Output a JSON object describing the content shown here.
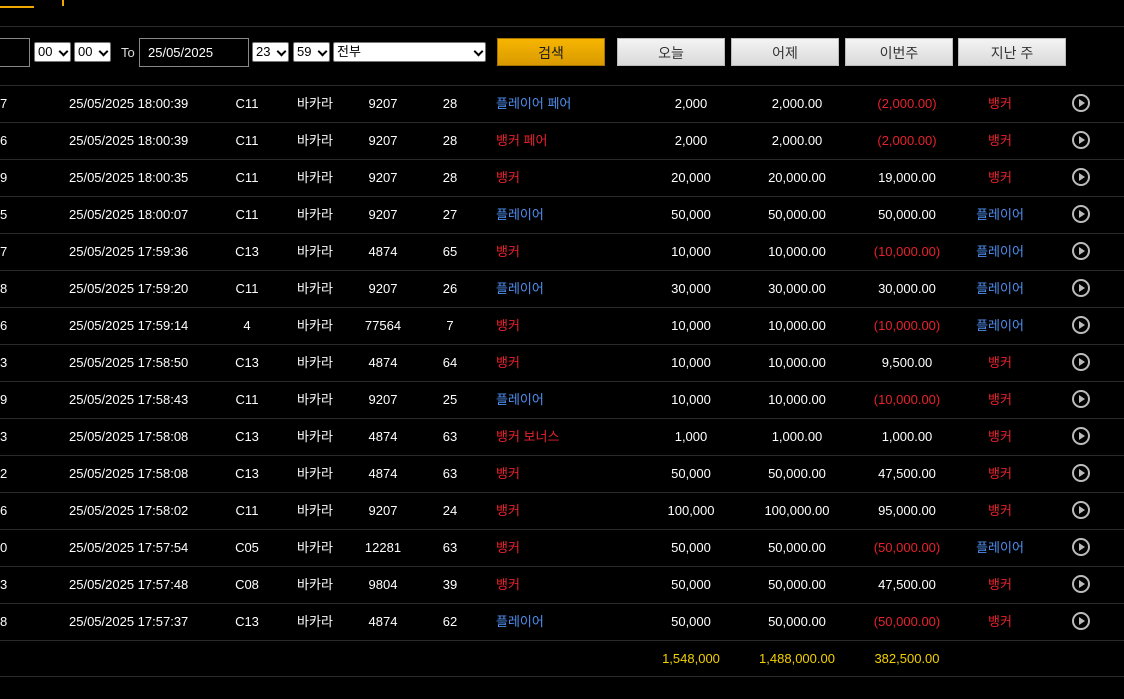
{
  "colors": {
    "accent": "#f0a800",
    "banker": "#e8212c",
    "player": "#4f8ff0",
    "total": "#f2d000"
  },
  "filters": {
    "from_hour": "00",
    "from_minute": "00",
    "to_label": "To",
    "to_date": "25/05/2025",
    "to_hour": "23",
    "to_minute": "59",
    "game_type": "전부",
    "search_label": "검색",
    "quick": [
      "오늘",
      "어제",
      "이번주",
      "지난 주"
    ]
  },
  "rows": [
    {
      "id": "7",
      "time": "25/05/2025 18:00:39",
      "table": "C11",
      "game": "바카라",
      "round": "9207",
      "shoe": "28",
      "bet": "플레이어 페어",
      "bet_color": "blue",
      "amount": "2,000",
      "valid": "2,000.00",
      "winloss": "(2,000.00)",
      "winloss_color": "red",
      "result": "뱅커",
      "result_color": "red"
    },
    {
      "id": "6",
      "time": "25/05/2025 18:00:39",
      "table": "C11",
      "game": "바카라",
      "round": "9207",
      "shoe": "28",
      "bet": "뱅커 페어",
      "bet_color": "red",
      "amount": "2,000",
      "valid": "2,000.00",
      "winloss": "(2,000.00)",
      "winloss_color": "red",
      "result": "뱅커",
      "result_color": "red"
    },
    {
      "id": "9",
      "time": "25/05/2025 18:00:35",
      "table": "C11",
      "game": "바카라",
      "round": "9207",
      "shoe": "28",
      "bet": "뱅커",
      "bet_color": "red",
      "amount": "20,000",
      "valid": "20,000.00",
      "winloss": "19,000.00",
      "winloss_color": "white",
      "result": "뱅커",
      "result_color": "red"
    },
    {
      "id": "5",
      "time": "25/05/2025 18:00:07",
      "table": "C11",
      "game": "바카라",
      "round": "9207",
      "shoe": "27",
      "bet": "플레이어",
      "bet_color": "blue",
      "amount": "50,000",
      "valid": "50,000.00",
      "winloss": "50,000.00",
      "winloss_color": "white",
      "result": "플레이어",
      "result_color": "blue"
    },
    {
      "id": "7",
      "time": "25/05/2025 17:59:36",
      "table": "C13",
      "game": "바카라",
      "round": "4874",
      "shoe": "65",
      "bet": "뱅커",
      "bet_color": "red",
      "amount": "10,000",
      "valid": "10,000.00",
      "winloss": "(10,000.00)",
      "winloss_color": "red",
      "result": "플레이어",
      "result_color": "blue"
    },
    {
      "id": "8",
      "time": "25/05/2025 17:59:20",
      "table": "C11",
      "game": "바카라",
      "round": "9207",
      "shoe": "26",
      "bet": "플레이어",
      "bet_color": "blue",
      "amount": "30,000",
      "valid": "30,000.00",
      "winloss": "30,000.00",
      "winloss_color": "white",
      "result": "플레이어",
      "result_color": "blue"
    },
    {
      "id": "6",
      "time": "25/05/2025 17:59:14",
      "table": "4",
      "game": "바카라",
      "round": "77564",
      "shoe": "7",
      "bet": "뱅커",
      "bet_color": "red",
      "amount": "10,000",
      "valid": "10,000.00",
      "winloss": "(10,000.00)",
      "winloss_color": "red",
      "result": "플레이어",
      "result_color": "blue"
    },
    {
      "id": "3",
      "time": "25/05/2025 17:58:50",
      "table": "C13",
      "game": "바카라",
      "round": "4874",
      "shoe": "64",
      "bet": "뱅커",
      "bet_color": "red",
      "amount": "10,000",
      "valid": "10,000.00",
      "winloss": "9,500.00",
      "winloss_color": "white",
      "result": "뱅커",
      "result_color": "red"
    },
    {
      "id": "9",
      "time": "25/05/2025 17:58:43",
      "table": "C11",
      "game": "바카라",
      "round": "9207",
      "shoe": "25",
      "bet": "플레이어",
      "bet_color": "blue",
      "amount": "10,000",
      "valid": "10,000.00",
      "winloss": "(10,000.00)",
      "winloss_color": "red",
      "result": "뱅커",
      "result_color": "red"
    },
    {
      "id": "3",
      "time": "25/05/2025 17:58:08",
      "table": "C13",
      "game": "바카라",
      "round": "4874",
      "shoe": "63",
      "bet": "뱅커 보너스",
      "bet_color": "red",
      "amount": "1,000",
      "valid": "1,000.00",
      "winloss": "1,000.00",
      "winloss_color": "white",
      "result": "뱅커",
      "result_color": "red"
    },
    {
      "id": "2",
      "time": "25/05/2025 17:58:08",
      "table": "C13",
      "game": "바카라",
      "round": "4874",
      "shoe": "63",
      "bet": "뱅커",
      "bet_color": "red",
      "amount": "50,000",
      "valid": "50,000.00",
      "winloss": "47,500.00",
      "winloss_color": "white",
      "result": "뱅커",
      "result_color": "red"
    },
    {
      "id": "6",
      "time": "25/05/2025 17:58:02",
      "table": "C11",
      "game": "바카라",
      "round": "9207",
      "shoe": "24",
      "bet": "뱅커",
      "bet_color": "red",
      "amount": "100,000",
      "valid": "100,000.00",
      "winloss": "95,000.00",
      "winloss_color": "white",
      "result": "뱅커",
      "result_color": "red"
    },
    {
      "id": "0",
      "time": "25/05/2025 17:57:54",
      "table": "C05",
      "game": "바카라",
      "round": "12281",
      "shoe": "63",
      "bet": "뱅커",
      "bet_color": "red",
      "amount": "50,000",
      "valid": "50,000.00",
      "winloss": "(50,000.00)",
      "winloss_color": "red",
      "result": "플레이어",
      "result_color": "blue"
    },
    {
      "id": "3",
      "time": "25/05/2025 17:57:48",
      "table": "C08",
      "game": "바카라",
      "round": "9804",
      "shoe": "39",
      "bet": "뱅커",
      "bet_color": "red",
      "amount": "50,000",
      "valid": "50,000.00",
      "winloss": "47,500.00",
      "winloss_color": "white",
      "result": "뱅커",
      "result_color": "red"
    },
    {
      "id": "8",
      "time": "25/05/2025 17:57:37",
      "table": "C13",
      "game": "바카라",
      "round": "4874",
      "shoe": "62",
      "bet": "플레이어",
      "bet_color": "blue",
      "amount": "50,000",
      "valid": "50,000.00",
      "winloss": "(50,000.00)",
      "winloss_color": "red",
      "result": "뱅커",
      "result_color": "red"
    }
  ],
  "totals": {
    "amount": "1,548,000",
    "valid": "1,488,000.00",
    "winloss": "382,500.00"
  },
  "icons": {
    "top_logo": "logo-mark-icon",
    "row_action": "play-circle-icon",
    "dropdown": "chevron-down-icon"
  }
}
